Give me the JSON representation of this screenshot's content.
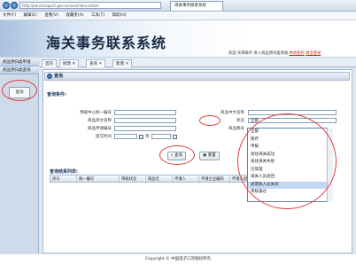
{
  "browser": {
    "address": "http://pw.chinaport.gov.cn/xxx/index.action",
    "tab_title": "海关事务联系系统",
    "menu": [
      "文件(F)",
      "编辑(E)",
      "查看(V)",
      "收藏夹(A)",
      "工具(T)",
      "帮助(H)"
    ]
  },
  "header": {
    "title": "海关事务联系系统",
    "welcome": "欢迎 天津联环 进入商品预归类系统",
    "links": [
      "修改密码",
      "退出登录"
    ]
  },
  "sidebar": {
    "items": [
      "商品预归类申请",
      "商品预归类查询"
    ],
    "query_label": "查询"
  },
  "tabs": [
    {
      "label": "首页",
      "closable": false
    },
    {
      "label": "修改",
      "closable": true
    },
    {
      "label": "查询",
      "closable": true,
      "active": true
    },
    {
      "label": "新增",
      "closable": true
    }
  ],
  "panel": {
    "title": "查询"
  },
  "query": {
    "section_label": "查询条件:",
    "fields": {
      "center_no": "预裁中心统一编号",
      "name_cn_left": "商品英文名称",
      "apply_no": "商品申请编号",
      "submit_time": "提交时间",
      "name_cn": "商品中文名称",
      "status": "状态",
      "code": "商品税号",
      "time_sep": "到"
    },
    "status_value": "全部",
    "buttons": {
      "search": "查询",
      "reset": "重置"
    }
  },
  "status_options": [
    "全部",
    "暂存",
    "申报",
    "发往海关成功",
    "发往海关失败",
    "已受理",
    "海关人员退回",
    "退票拟人员关闭",
    "审核通过"
  ],
  "status_selected_index": 7,
  "results": {
    "section_label": "查询结果列表:",
    "columns": [
      "序号",
      "统一编号",
      "审核状态",
      "商品名",
      "申请人",
      "申请企业编码",
      "申请人退",
      "状态"
    ]
  },
  "footer": "Copyright © 中国电子口岸版权所有"
}
